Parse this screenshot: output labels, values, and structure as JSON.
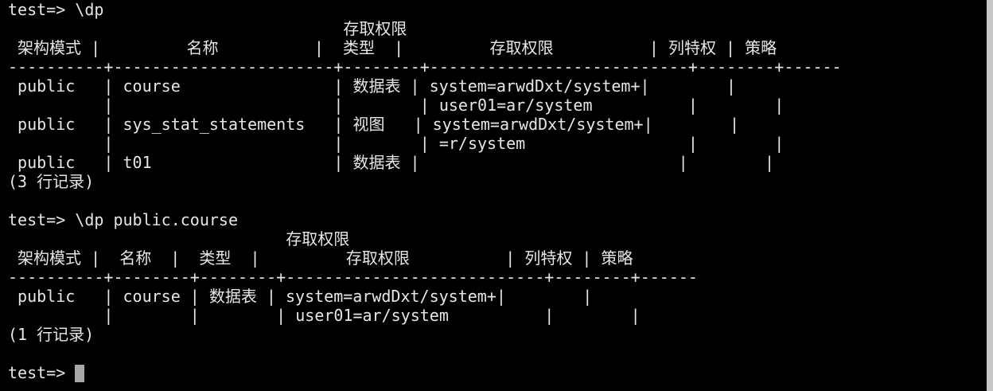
{
  "terminal": {
    "lines": [
      "test=> \\dp",
      "                                   存取权限",
      " 架构模式 |         名称          |  类型  |         存取权限          | 列特权 | 策略",
      "----------+-----------------------+--------+---------------------------+--------+------",
      " public   | course                | 数据表 | system=arwdDxt/system+|        |",
      "          |                       |        | user01=ar/system          |        |",
      " public   | sys_stat_statements   | 视图   | system=arwdDxt/system+|        |",
      "          |                       |        | =r/system                 |        |",
      " public   | t01                   | 数据表 |                           |        |",
      "(3 行记录)",
      "",
      "test=> \\dp public.course",
      "                             存取权限",
      " 架构模式 |  名称  |  类型  |         存取权限          | 列特权 | 策略",
      "----------+--------+--------+---------------------------+--------+------",
      " public   | course | 数据表 | system=arwdDxt/system+|        |",
      "          |        |        | user01=ar/system          |        |",
      "(1 行记录)",
      "",
      "test=> "
    ]
  }
}
